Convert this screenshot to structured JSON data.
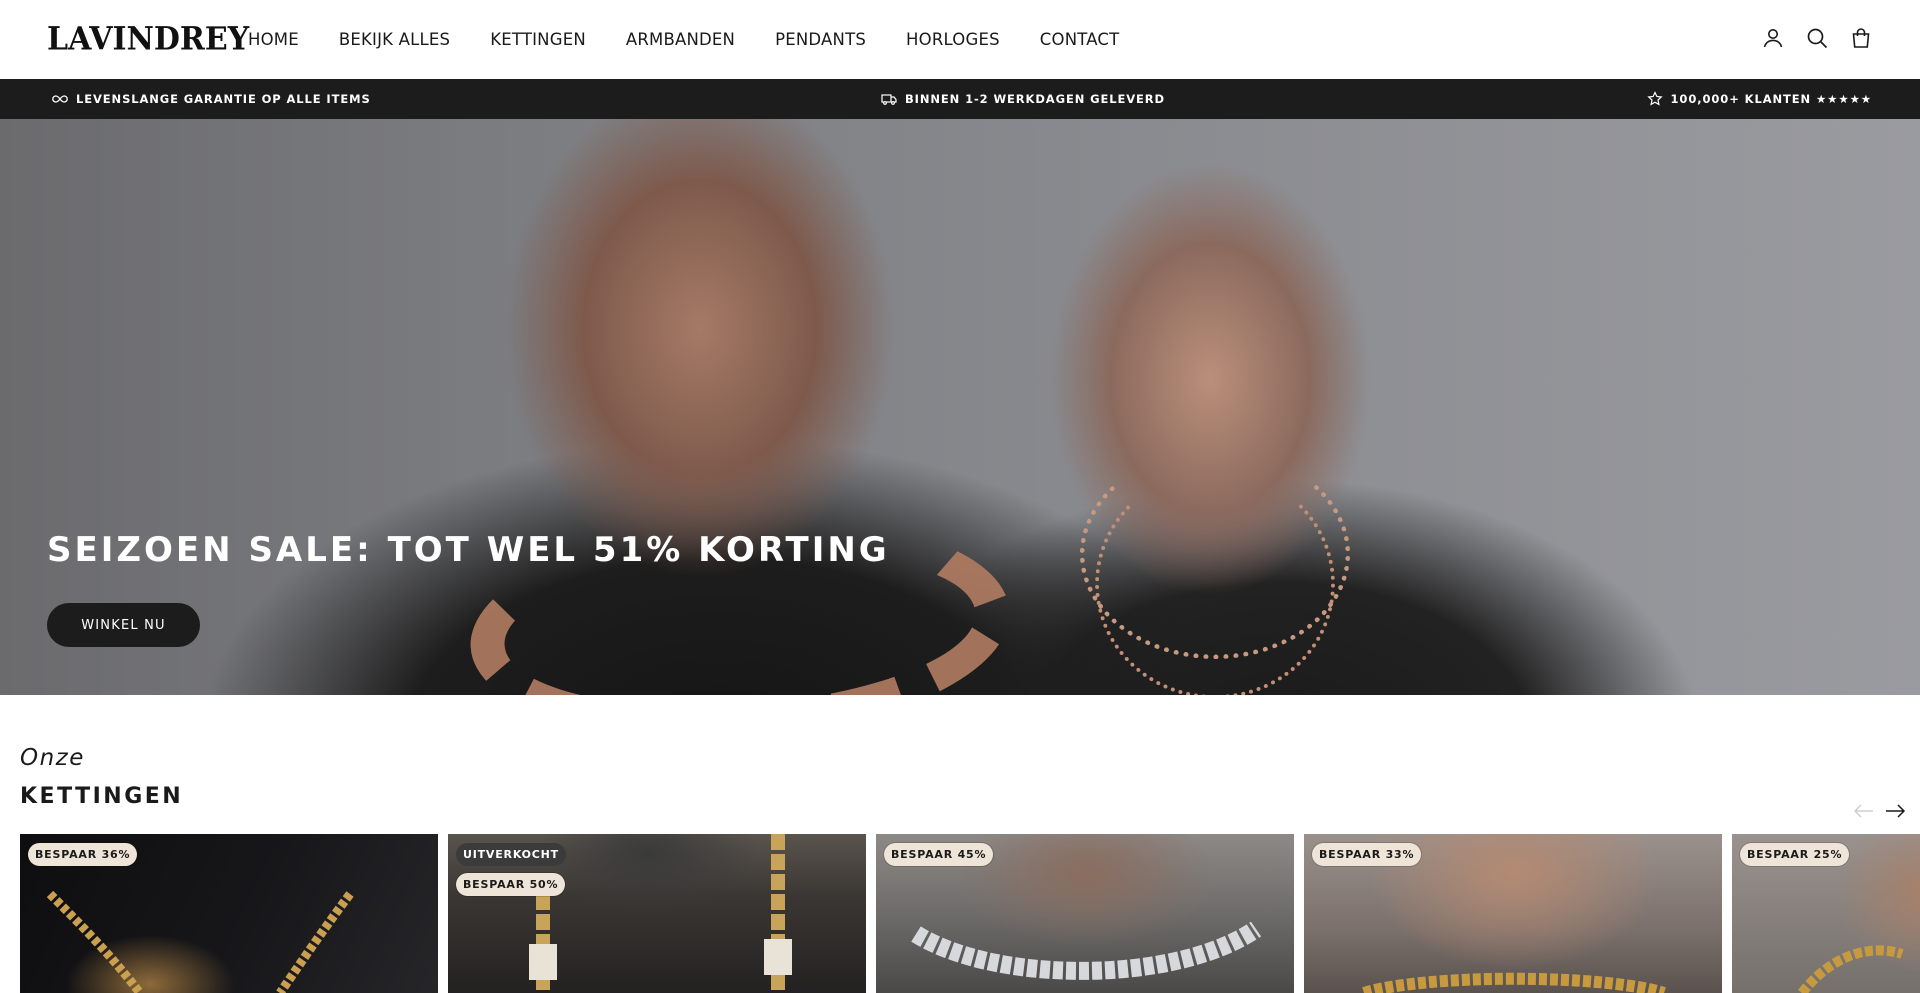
{
  "header": {
    "logo": "LAVINDREY",
    "nav": [
      "HOME",
      "BEKIJK ALLES",
      "KETTINGEN",
      "ARMBANDEN",
      "PENDANTS",
      "HORLOGES",
      "CONTACT"
    ],
    "icons": [
      "account-icon",
      "search-icon",
      "cart-icon"
    ]
  },
  "announcement": {
    "left": "LEVENSLANGE GARANTIE OP ALLE ITEMS",
    "center": "BINNEN 1-2 WERKDAGEN GELEVERD",
    "right": "100,000+ KLANTEN ★★★★★"
  },
  "hero": {
    "title": "SEIZOEN SALE: TOT WEL 51% KORTING",
    "button": "WINKEL NU"
  },
  "section": {
    "subtitle": "Onze",
    "title": "KETTINGEN"
  },
  "products": [
    {
      "badges": [
        "BESPAAR 36%"
      ]
    },
    {
      "badges": [
        "UITVERKOCHT",
        "BESPAAR 50%"
      ]
    },
    {
      "badges": [
        "BESPAAR 45%"
      ]
    },
    {
      "badges": [
        "BESPAAR 33%"
      ]
    },
    {
      "badges": [
        "BESPAAR 25%"
      ]
    }
  ],
  "colors": {
    "announce_bg": "#1c1c1c",
    "badge_bg": "#efe4d8",
    "button_bg": "#1c1c1c"
  }
}
